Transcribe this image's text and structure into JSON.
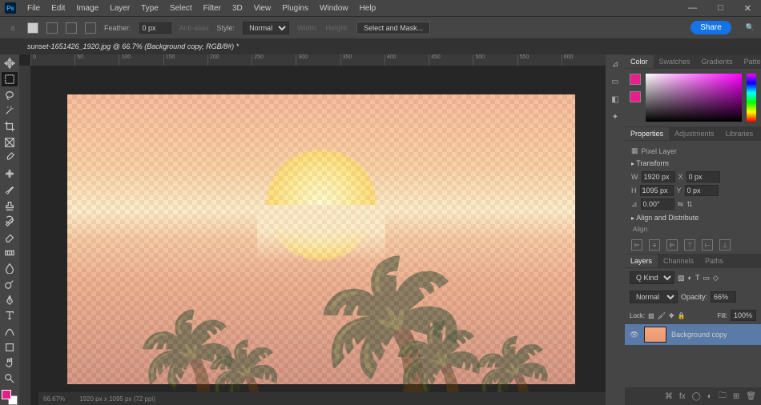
{
  "menu": {
    "items": [
      "File",
      "Edit",
      "Image",
      "Layer",
      "Type",
      "Select",
      "Filter",
      "3D",
      "View",
      "Plugins",
      "Window",
      "Help"
    ],
    "logo": "Ps"
  },
  "wctrl": {
    "min": "—",
    "max": "□",
    "close": "✕"
  },
  "options": {
    "feather_label": "Feather:",
    "feather": "0 px",
    "antialias": "Anti-alias",
    "style_label": "Style:",
    "style": "Normal",
    "width_label": "Width:",
    "height_label": "Height:",
    "mask": "Select and Mask...",
    "share": "Share",
    "search": "🔍"
  },
  "tab": {
    "title": "sunset-1651426_1920.jpg @ 66.7% (Background copy, RGB/8#) *"
  },
  "ruler": [
    "0",
    "50",
    "100",
    "150",
    "200",
    "250",
    "300",
    "350",
    "400",
    "450",
    "500",
    "550",
    "600"
  ],
  "color": {
    "tabs": [
      "Color",
      "Swatches",
      "Gradients",
      "Patterns"
    ],
    "fg": "#e91e8c",
    "bg": "#ffffff"
  },
  "properties": {
    "tabs": [
      "Properties",
      "Adjustments",
      "Libraries"
    ],
    "type": "Pixel Layer",
    "transform": "Transform",
    "w_label": "W",
    "w": "1920 px",
    "h_label": "H",
    "h": "1095 px",
    "x_label": "X",
    "x": "0 px",
    "y_label": "Y",
    "y": "0 px",
    "angle_label": "⊿",
    "angle": "0.00°",
    "align_hdr": "Align and Distribute",
    "align_label": "Align:"
  },
  "layers": {
    "tabs": [
      "Layers",
      "Channels",
      "Paths"
    ],
    "kind": "Q Kind",
    "blend": "Normal",
    "opacity_label": "Opacity:",
    "opacity": "66%",
    "lock_label": "Lock:",
    "fill_label": "Fill:",
    "fill": "100%",
    "layer_name": "Background copy"
  },
  "status": {
    "zoom": "66.67%",
    "dims": "1920 px x 1095 px (72 ppi)"
  }
}
